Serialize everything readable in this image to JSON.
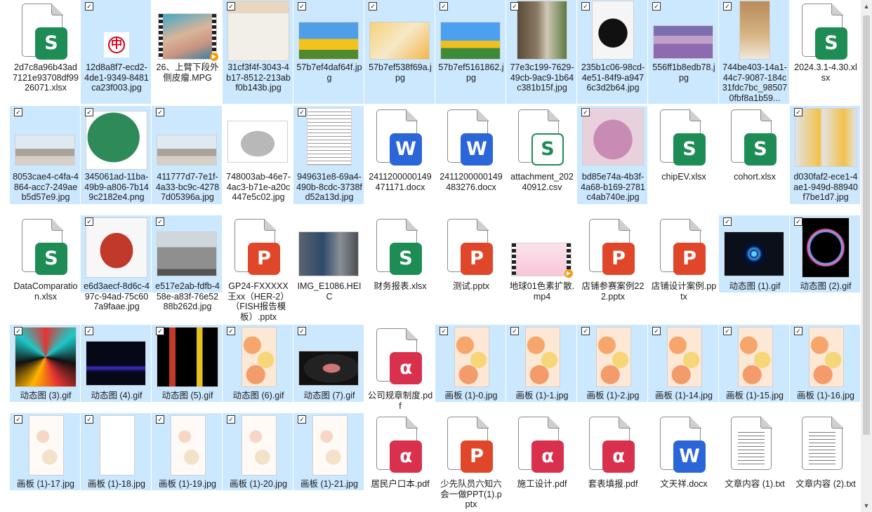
{
  "files": [
    {
      "name": "2d7c8a96b43ad7121e93708df9926071.xlsx",
      "kind": "xlsx",
      "sel": false
    },
    {
      "name": "12d8a8f7-ecd2-4de1-9349-8481ca23f003.jpg",
      "kind": "img",
      "style": "logo",
      "sel": true
    },
    {
      "name": "26、上臂下段外侧皮瘤.MPG",
      "kind": "video",
      "style": "skin",
      "sel": false
    },
    {
      "name": "31cf3f4f-3043-4b17-8512-213abf0b143b.jpg",
      "kind": "img",
      "style": "ad",
      "sel": true
    },
    {
      "name": "57b7ef4daf64f.jpg",
      "kind": "img",
      "style": "sunflower1",
      "sel": true
    },
    {
      "name": "57b7ef538f69a.jpg",
      "kind": "img",
      "style": "sunflower2",
      "sel": true
    },
    {
      "name": "57b7ef5161862.jpg",
      "kind": "img",
      "style": "sunflower3",
      "sel": true
    },
    {
      "name": "77e3c199-7629-49cb-9ac9-1b64c381b15f.jpg",
      "kind": "img",
      "style": "plant",
      "sel": true
    },
    {
      "name": "235b1c06-98cd-4e51-84f9-a9476c3d2b64.jpg",
      "kind": "img",
      "style": "tshirt",
      "sel": true
    },
    {
      "name": "556ff1b8edb78.jpg",
      "kind": "img",
      "style": "lavender",
      "sel": true
    },
    {
      "name": "744be403-14a1-44c7-9087-184c31fdc7bc_985070fbf8a1b59...",
      "kind": "img",
      "style": "box",
      "sel": true
    },
    {
      "name": "2024.3.1-4.30.xlsx",
      "kind": "xlsx",
      "sel": false
    },
    {
      "name": "8053cae4-c4fa-4864-acc7-249aeb5d57e9.jpg",
      "kind": "img",
      "style": "park",
      "sel": true
    },
    {
      "name": "345061ad-11ba-49b9-a806-7b149c2182e4.png",
      "kind": "img",
      "style": "map",
      "sel": true
    },
    {
      "name": "411777d7-7e1f-4a33-bc9c-42787d05396a.jpg",
      "kind": "img",
      "style": "park",
      "sel": true
    },
    {
      "name": "748003ab-46e7-4ac3-b71e-a20c447e5c02.jpg",
      "kind": "img",
      "style": "shoe",
      "sel": false
    },
    {
      "name": "949631e8-69a4-490b-8cdc-3738fd52a13d.jpg",
      "kind": "img",
      "style": "sheet",
      "sel": true
    },
    {
      "name": "2411200000149471171.docx",
      "kind": "docx",
      "sel": false
    },
    {
      "name": "2411200000149483276.docx",
      "kind": "docx",
      "sel": false
    },
    {
      "name": "attachment_20240912.csv",
      "kind": "csv",
      "sel": false
    },
    {
      "name": "bd85e74a-4b3f-4a68-b169-2781c4ab740e.jpg",
      "kind": "img",
      "style": "slippers",
      "sel": true
    },
    {
      "name": "chipEV.xlsx",
      "kind": "xlsx",
      "sel": false
    },
    {
      "name": "cohort.xlsx",
      "kind": "xlsx",
      "sel": false
    },
    {
      "name": "d030faf2-ece1-4ae1-949d-88940f7be1d7.jpg",
      "kind": "img",
      "style": "shelf",
      "sel": true
    },
    {
      "name": "DataComparation.xlsx",
      "kind": "xlsx",
      "sel": false
    },
    {
      "name": "e6d3aecf-8d6c-497c-94ad-75c607a9faae.jpg",
      "kind": "img",
      "style": "redshoes",
      "sel": true
    },
    {
      "name": "e517e2ab-fdfb-458e-a83f-76e5288b262d.jpg",
      "kind": "img",
      "style": "stone",
      "sel": true
    },
    {
      "name": "GP24-FXXXXX王xx（HER-2）（FISH报告模板）.pptx",
      "kind": "pptx",
      "sel": false
    },
    {
      "name": "IMG_E1086.HEIC",
      "kind": "img",
      "style": "factory",
      "sel": false
    },
    {
      "name": "财务报表.xlsx",
      "kind": "xlsx",
      "sel": false
    },
    {
      "name": "测试.pptx",
      "kind": "pptx",
      "sel": false
    },
    {
      "name": "地球01色素扩散.mp4",
      "kind": "video",
      "style": "pink",
      "sel": false
    },
    {
      "name": "店铺参赛案例222.pptx",
      "kind": "pptx",
      "sel": false
    },
    {
      "name": "店铺设计案例.pptx",
      "kind": "pptx",
      "sel": false
    },
    {
      "name": "动态图 (1).gif",
      "kind": "img",
      "style": "rings",
      "sel": true
    },
    {
      "name": "动态图 (2).gif",
      "kind": "img",
      "style": "bubble",
      "sel": true
    },
    {
      "name": "动态图 (3).gif",
      "kind": "img",
      "style": "hex",
      "sel": true
    },
    {
      "name": "动态图 (4).gif",
      "kind": "img",
      "style": "wave",
      "sel": true
    },
    {
      "name": "动态图 (5).gif",
      "kind": "img",
      "style": "figures",
      "sel": true
    },
    {
      "name": "动态图 (6).gif",
      "kind": "img",
      "style": "camo",
      "sel": true
    },
    {
      "name": "动态图 (7).gif",
      "kind": "img",
      "style": "screen",
      "sel": true
    },
    {
      "name": "公司规章制度.pdf",
      "kind": "pdf",
      "sel": false
    },
    {
      "name": "画板 (1)-0.jpg",
      "kind": "img",
      "style": "camo",
      "sel": true
    },
    {
      "name": "画板 (1)-1.jpg",
      "kind": "img",
      "style": "camo",
      "sel": true
    },
    {
      "name": "画板 (1)-2.jpg",
      "kind": "img",
      "style": "camo",
      "sel": true
    },
    {
      "name": "画板 (1)-14.jpg",
      "kind": "img",
      "style": "camo",
      "sel": true
    },
    {
      "name": "画板 (1)-15.jpg",
      "kind": "img",
      "style": "camo",
      "sel": true
    },
    {
      "name": "画板 (1)-16.jpg",
      "kind": "img",
      "style": "camo",
      "sel": true
    },
    {
      "name": "画板 (1)-17.jpg",
      "kind": "img",
      "style": "pale",
      "sel": true
    },
    {
      "name": "画板 (1)-18.jpg",
      "kind": "img",
      "style": "blank",
      "sel": true
    },
    {
      "name": "画板 (1)-19.jpg",
      "kind": "img",
      "style": "pale",
      "sel": true
    },
    {
      "name": "画板 (1)-20.jpg",
      "kind": "img",
      "style": "pale",
      "sel": true
    },
    {
      "name": "画板 (1)-21.jpg",
      "kind": "img",
      "style": "pale",
      "sel": true
    },
    {
      "name": "居民户口本.pdf",
      "kind": "pdf",
      "sel": false
    },
    {
      "name": "少先队员六知六会一做PPT(1).pptx",
      "kind": "pptx",
      "sel": false
    },
    {
      "name": "施工设计.pdf",
      "kind": "pdf",
      "sel": false
    },
    {
      "name": "套表填报.pdf",
      "kind": "pdf",
      "sel": false
    },
    {
      "name": "文天祥.docx",
      "kind": "docx",
      "sel": false
    },
    {
      "name": "文章内容 (1).txt",
      "kind": "txt",
      "sel": false
    },
    {
      "name": "文章内容 (2).txt",
      "kind": "txt",
      "sel": false
    }
  ],
  "icon_letters": {
    "xlsx": "S",
    "docx": "W",
    "pptx": "P",
    "pdf": "⍺",
    "csv": "S"
  },
  "thumb_logo_glyph": "中",
  "scroll_arrows": {
    "up": "▲",
    "down": "▼"
  },
  "colors": {
    "selection": "#cce8ff",
    "excel": "#1e8c55",
    "word": "#2b66d9",
    "powerpoint": "#e0462a",
    "pdf": "#d9304e"
  }
}
